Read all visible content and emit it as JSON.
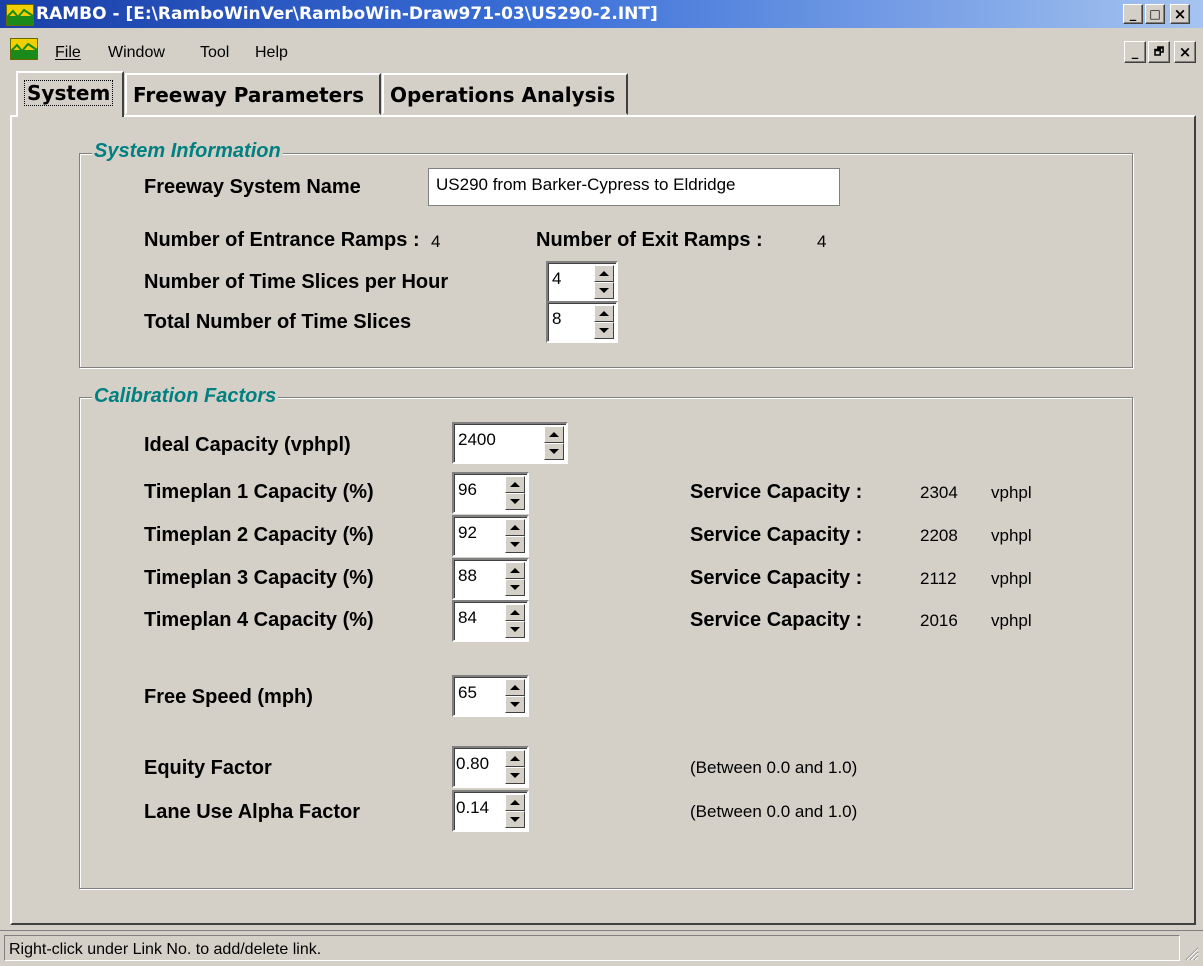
{
  "window": {
    "title": "RAMBO - [E:\\RamboWinVer\\RamboWin-Draw971-03\\US290-2.INT]",
    "minimize": "_",
    "maximize": "□",
    "restore": "🗗",
    "close": "×"
  },
  "menu": [
    {
      "label": "File",
      "key": "F"
    },
    {
      "label": "Window",
      "key": "W"
    },
    {
      "label": "Tool",
      "key": "T"
    },
    {
      "label": "Help",
      "key": "H"
    }
  ],
  "tabs": [
    "System",
    "Freeway Parameters",
    "Operations Analysis"
  ],
  "system_info": {
    "legend": "System Information",
    "name_label": "Freeway System Name",
    "name_value": "US290 from Barker-Cypress to Eldridge",
    "entrance_label": "Number of Entrance Ramps :",
    "entrance_value": "4",
    "exit_label": "Number of Exit Ramps :",
    "exit_value": "4",
    "slices_per_hour_label": "Number of Time Slices per Hour",
    "slices_per_hour_value": "4",
    "total_slices_label": "Total Number of Time Slices",
    "total_slices_value": "8"
  },
  "calibration": {
    "legend": "Calibration Factors",
    "ideal_capacity_label": "Ideal Capacity (vphpl)",
    "ideal_capacity_value": "2400",
    "timeplans": [
      {
        "label": "Timeplan 1 Capacity (%)",
        "value": "96",
        "service_label": "Service Capacity :",
        "service_value": "2304",
        "unit": "vphpl"
      },
      {
        "label": "Timeplan 2 Capacity (%)",
        "value": "92",
        "service_label": "Service Capacity :",
        "service_value": "2208",
        "unit": "vphpl"
      },
      {
        "label": "Timeplan 3 Capacity (%)",
        "value": "88",
        "service_label": "Service Capacity :",
        "service_value": "2112",
        "unit": "vphpl"
      },
      {
        "label": "Timeplan 4 Capacity (%)",
        "value": "84",
        "service_label": "Service Capacity :",
        "service_value": "2016",
        "unit": "vphpl"
      }
    ],
    "free_speed_label": "Free Speed (mph)",
    "free_speed_value": "65",
    "equity_label": "Equity Factor",
    "equity_value": "0.80",
    "equity_hint": "(Between 0.0 and 1.0)",
    "alpha_label": "Lane Use Alpha Factor",
    "alpha_value": "0.14",
    "alpha_hint": "(Between 0.0 and 1.0)"
  },
  "status": "Right-click under Link No. to add/delete link.",
  "colors": {
    "legend": "#008080",
    "face": "#d4d0c8",
    "title_start": "#1a3fa8",
    "title_end": "#a6c4f0"
  }
}
